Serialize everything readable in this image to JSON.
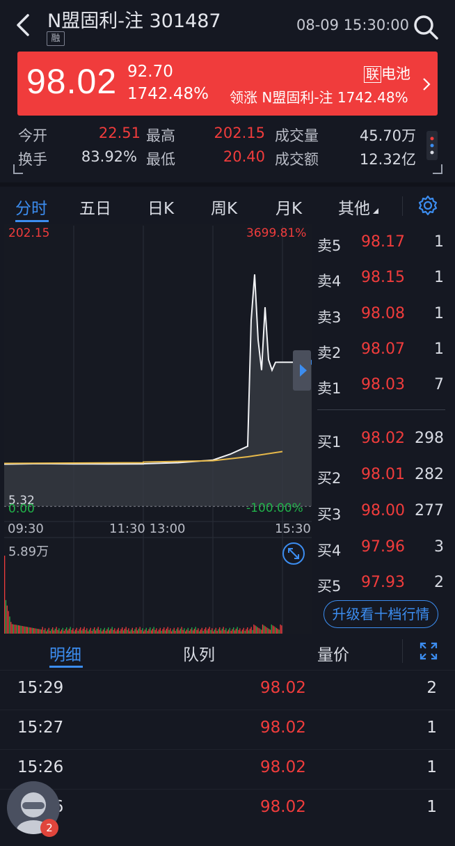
{
  "header": {
    "title": "N盟固利-注 301487",
    "margin_badge": "融",
    "datetime": "08-09 15:30:00"
  },
  "banner": {
    "price": "98.02",
    "change": "92.70",
    "change_pct": "1742.48%",
    "sector_tag": "联",
    "sector_name": "电池",
    "leader_text": "领涨 N盟固利-注 1742.48%",
    "color": "#f03c3c"
  },
  "stats": {
    "open_label": "今开",
    "open": "22.51",
    "high_label": "最高",
    "high": "202.15",
    "volume_label": "成交量",
    "volume": "45.70万",
    "turnover_label": "换手",
    "turnover": "83.92%",
    "low_label": "最低",
    "low": "20.40",
    "amount_label": "成交额",
    "amount": "12.32亿"
  },
  "tabs": [
    "分时",
    "五日",
    "日K",
    "周K",
    "月K",
    "其他"
  ],
  "chart": {
    "y_max": "202.15",
    "y_max_pct": "3699.81%",
    "y_min": "5.32",
    "y_min2": "0.00",
    "y_min_pct": "-100.00%",
    "x_labels": [
      "09:30",
      "11:30 13:00",
      "15:30"
    ],
    "volume_max": "5.89万"
  },
  "chart_data": {
    "type": "line",
    "title": "",
    "xlabel": "",
    "ylabel": "",
    "ylim": [
      5.32,
      202.15
    ],
    "series": [
      {
        "x": [
          "09:30",
          "10:00",
          "10:30",
          "11:00",
          "11:30",
          "13:00",
          "13:30",
          "14:00",
          "14:15",
          "14:30",
          "14:33",
          "14:36",
          "14:39",
          "14:42",
          "14:45",
          "14:48",
          "14:51",
          "14:54",
          "14:57",
          "15:00",
          "15:30"
        ],
        "values": [
          20.4,
          20.8,
          20.6,
          20.5,
          20.6,
          20.7,
          21.5,
          23.5,
          28,
          34,
          130,
          165,
          115,
          92,
          140,
          100,
          92,
          98,
          98.02,
          98.02,
          98.02
        ]
      },
      {
        "x": [
          "09:30",
          "11:30",
          "13:00",
          "14:00",
          "14:30",
          "15:00"
        ],
        "values": [
          21.0,
          21.5,
          22.0,
          23.0,
          26.0,
          30.0
        ]
      }
    ],
    "grid": true
  },
  "orderbook": {
    "asks": [
      {
        "label": "卖5",
        "price": "98.17",
        "vol": "1"
      },
      {
        "label": "卖4",
        "price": "98.15",
        "vol": "1"
      },
      {
        "label": "卖3",
        "price": "98.08",
        "vol": "1"
      },
      {
        "label": "卖2",
        "price": "98.07",
        "vol": "1"
      },
      {
        "label": "卖1",
        "price": "98.03",
        "vol": "7"
      }
    ],
    "bids": [
      {
        "label": "买1",
        "price": "98.02",
        "vol": "298"
      },
      {
        "label": "买2",
        "price": "98.01",
        "vol": "282"
      },
      {
        "label": "买3",
        "price": "98.00",
        "vol": "277"
      },
      {
        "label": "买4",
        "price": "97.96",
        "vol": "3"
      },
      {
        "label": "买5",
        "price": "97.93",
        "vol": "2"
      }
    ],
    "upgrade_label": "升级看十档行情"
  },
  "bottom_tabs": [
    "明细",
    "队列",
    "量价"
  ],
  "ticks": [
    {
      "time": "15:29",
      "price": "98.02",
      "vol": "2"
    },
    {
      "time": "15:27",
      "price": "98.02",
      "vol": "1"
    },
    {
      "time": "15:26",
      "price": "98.02",
      "vol": "1"
    },
    {
      "time": "15:26",
      "price": "98.02",
      "vol": "1"
    }
  ],
  "notification_count": "2"
}
